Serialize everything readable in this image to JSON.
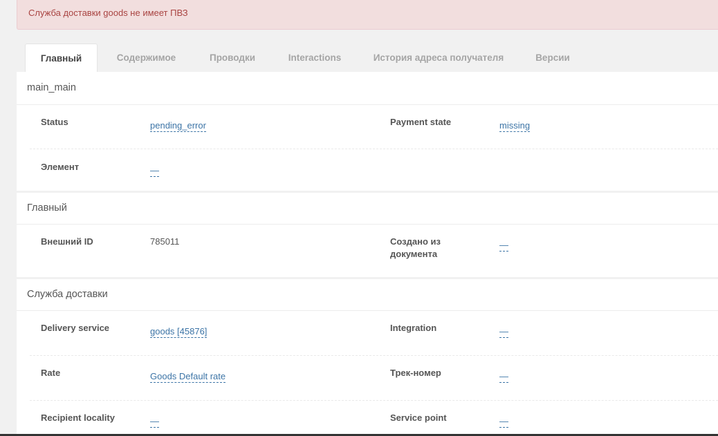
{
  "alert": {
    "message": "Служба доставки goods не имеет ПВЗ"
  },
  "tabs": [
    {
      "label": "Главный"
    },
    {
      "label": "Содержимое"
    },
    {
      "label": "Проводки"
    },
    {
      "label": "Interactions"
    },
    {
      "label": "История адреса получателя"
    },
    {
      "label": "Версии"
    }
  ],
  "section_main": {
    "title": "main_main",
    "status_label": "Status",
    "status_value": "pending_error",
    "payment_label": "Payment state",
    "payment_value": "missing",
    "element_label": "Элемент",
    "element_value": "—"
  },
  "section_general": {
    "title": "Главный",
    "external_id_label": "Внешний ID",
    "external_id_value": "785011",
    "created_from_label": "Создано из документа",
    "created_from_value": "—"
  },
  "section_delivery": {
    "title": "Служба доставки",
    "delivery_service_label": "Delivery service",
    "delivery_service_value": "goods [45876]",
    "integration_label": "Integration",
    "integration_value": "—",
    "rate_label": "Rate",
    "rate_value": "Goods Default rate",
    "track_label": "Трек-номер",
    "track_value": "—",
    "recipient_locality_label": "Recipient locality",
    "recipient_locality_value": "—",
    "service_point_label": "Service point",
    "service_point_value": "—"
  }
}
